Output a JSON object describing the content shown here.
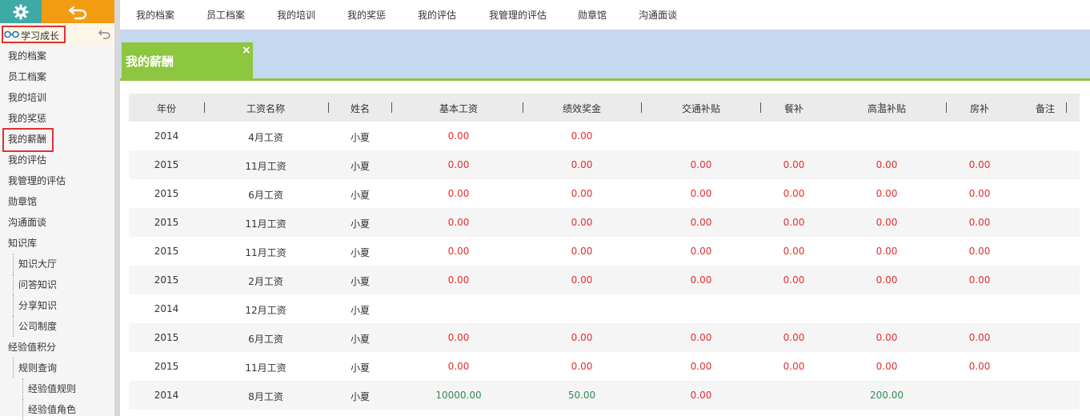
{
  "sidebar": {
    "section_label": "学习成长",
    "items": [
      {
        "label": "我的档案",
        "level": 0
      },
      {
        "label": "员工档案",
        "level": 0
      },
      {
        "label": "我的培训",
        "level": 0
      },
      {
        "label": "我的奖惩",
        "level": 0
      },
      {
        "label": "我的薪酬",
        "level": 0,
        "active": true
      },
      {
        "label": "我的评估",
        "level": 0
      },
      {
        "label": "我管理的评估",
        "level": 0
      },
      {
        "label": "勋章馆",
        "level": 0
      },
      {
        "label": "沟通面谈",
        "level": 0
      },
      {
        "label": "知识库",
        "level": 0
      },
      {
        "label": "知识大厅",
        "level": 1
      },
      {
        "label": "问答知识",
        "level": 1
      },
      {
        "label": "分享知识",
        "level": 1
      },
      {
        "label": "公司制度",
        "level": 1
      },
      {
        "label": "经验值积分",
        "level": 0
      },
      {
        "label": "规则查询",
        "level": 1
      },
      {
        "label": "经验值规则",
        "level": 2
      },
      {
        "label": "经验值角色",
        "level": 2
      }
    ]
  },
  "topnav": {
    "items": [
      "我的档案",
      "员工档案",
      "我的培训",
      "我的奖惩",
      "我的评估",
      "我管理的评估",
      "勋章馆",
      "沟通面谈"
    ]
  },
  "tab": {
    "title": "我的薪酬",
    "close": "×"
  },
  "table": {
    "headers": [
      "年份",
      "工资名称",
      "姓名",
      "基本工资",
      "绩效奖金",
      "交通补贴",
      "餐补",
      "高温补贴",
      "房补",
      "备注"
    ],
    "rows": [
      [
        "2014",
        "4月工资",
        "小夏",
        "0.00",
        "0.00",
        "",
        "",
        "",
        "",
        ""
      ],
      [
        "2015",
        "11月工资",
        "小夏",
        "0.00",
        "0.00",
        "0.00",
        "0.00",
        "0.00",
        "0.00",
        ""
      ],
      [
        "2015",
        "6月工资",
        "小夏",
        "0.00",
        "0.00",
        "0.00",
        "0.00",
        "0.00",
        "0.00",
        ""
      ],
      [
        "2015",
        "11月工资",
        "小夏",
        "0.00",
        "0.00",
        "0.00",
        "0.00",
        "0.00",
        "0.00",
        ""
      ],
      [
        "2015",
        "11月工资",
        "小夏",
        "0.00",
        "0.00",
        "0.00",
        "0.00",
        "0.00",
        "0.00",
        ""
      ],
      [
        "2015",
        "2月工资",
        "小夏",
        "0.00",
        "0.00",
        "0.00",
        "0.00",
        "0.00",
        "0.00",
        ""
      ],
      [
        "2014",
        "12月工资",
        "小夏",
        "",
        "",
        "",
        "",
        "",
        "",
        ""
      ],
      [
        "2015",
        "6月工资",
        "小夏",
        "0.00",
        "0.00",
        "0.00",
        "0.00",
        "0.00",
        "0.00",
        ""
      ],
      [
        "2015",
        "11月工资",
        "小夏",
        "0.00",
        "0.00",
        "0.00",
        "0.00",
        "0.00",
        "0.00",
        ""
      ],
      [
        "2014",
        "8月工资",
        "小夏",
        "10000.00",
        "50.00",
        "0.00",
        "",
        "200.00",
        "",
        ""
      ]
    ]
  },
  "colors": {
    "accent_teal": "#3fa9a5",
    "accent_orange": "#f39c12",
    "tab_green": "#8dc63f",
    "band_blue": "#c5d9f1",
    "zero_red": "#e0302f",
    "positive_green": "#2e8b57",
    "highlight_red": "#e0302f"
  },
  "icons": {
    "settings": "gear-icon",
    "back": "undo-arrow-icon",
    "section": "glasses-icon",
    "section_back": "undo-icon",
    "close": "close-icon"
  }
}
